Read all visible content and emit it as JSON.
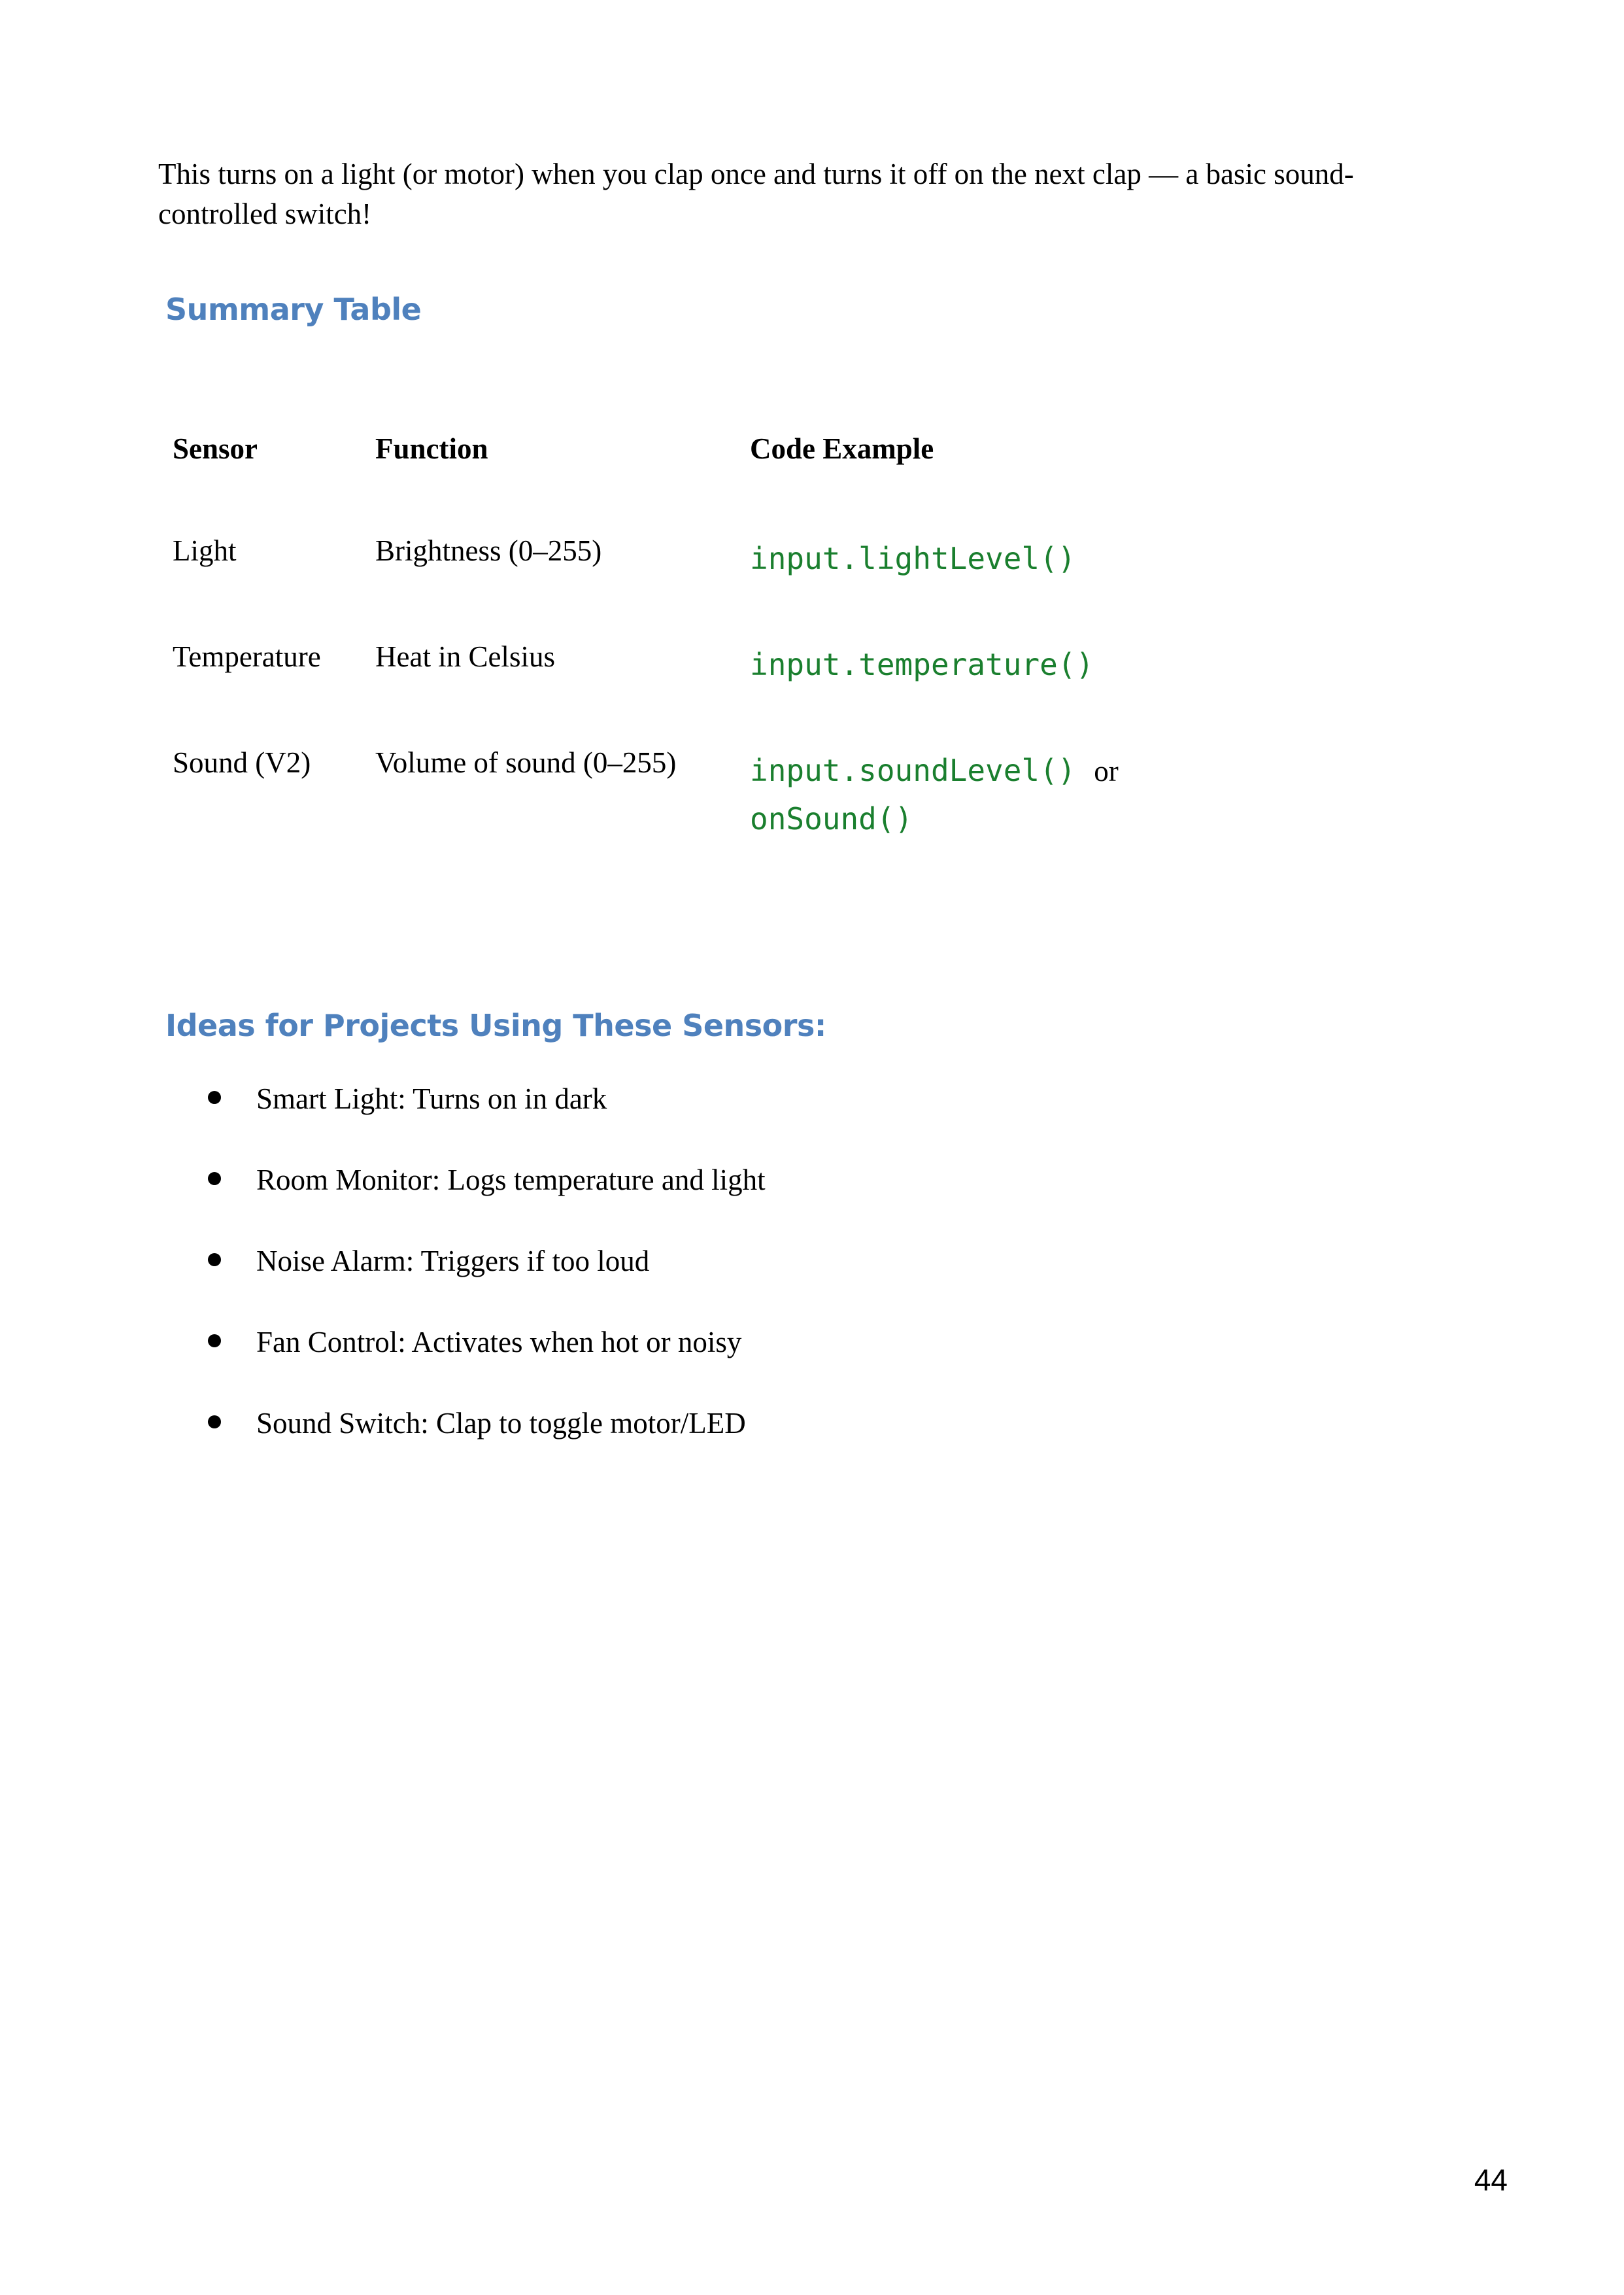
{
  "intro": {
    "text": "This turns on a light (or motor) when you clap once and turns it off on the next clap — a basic sound-controlled switch!"
  },
  "summary": {
    "heading": "Summary Table",
    "table": {
      "headers": [
        "Sensor",
        "Function",
        "Code Example"
      ],
      "rows": [
        {
          "sensor": "Light",
          "function": "Brightness (0–255)",
          "code": "input.lightLevel()"
        },
        {
          "sensor": "Temperature",
          "function": "Heat in Celsius",
          "code": "input.temperature()"
        },
        {
          "sensor": "Sound (V2)",
          "function": "Volume of sound (0–255)",
          "code": "input.soundLevel()",
          "connector": "or",
          "code2": "onSound()"
        }
      ]
    }
  },
  "ideas": {
    "heading": "Ideas for Projects Using These Sensors:",
    "items": [
      "Smart Light: Turns on in dark",
      "Room Monitor: Logs temperature and light",
      "Noise Alarm: Triggers if too loud",
      "Fan Control: Activates when hot or noisy",
      "Sound Switch: Clap to toggle motor/LED"
    ]
  },
  "footer": {
    "page_number": "44"
  },
  "colors": {
    "heading": "#4f81bd",
    "code": "#1a7f2e"
  }
}
